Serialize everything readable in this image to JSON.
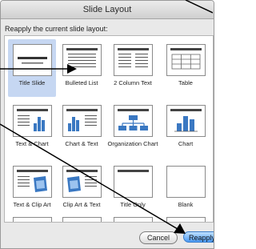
{
  "window": {
    "title": "Slide Layout"
  },
  "instruction": "Reapply the current slide layout:",
  "layouts": [
    {
      "label": "Title Slide",
      "selected": true,
      "icon": "layout-title-slide-icon"
    },
    {
      "label": "Bulleted List",
      "selected": false,
      "icon": "layout-bulleted-list-icon"
    },
    {
      "label": "2 Column Text",
      "selected": false,
      "icon": "layout-two-column-text-icon"
    },
    {
      "label": "Table",
      "selected": false,
      "icon": "layout-table-icon"
    },
    {
      "label": "Text & Chart",
      "selected": false,
      "icon": "layout-text-and-chart-icon"
    },
    {
      "label": "Chart & Text",
      "selected": false,
      "icon": "layout-chart-and-text-icon"
    },
    {
      "label": "Organization Chart",
      "selected": false,
      "icon": "layout-organization-chart-icon"
    },
    {
      "label": "Chart",
      "selected": false,
      "icon": "layout-chart-icon"
    },
    {
      "label": "Text & Clip Art",
      "selected": false,
      "icon": "layout-text-and-clip-art-icon"
    },
    {
      "label": "Clip Art & Text",
      "selected": false,
      "icon": "layout-clip-art-and-text-icon"
    },
    {
      "label": "Title Only",
      "selected": false,
      "icon": "layout-title-only-icon"
    },
    {
      "label": "Blank",
      "selected": false,
      "icon": "layout-blank-icon"
    }
  ],
  "buttons": {
    "cancel": "Cancel",
    "reapply": "Reapply"
  },
  "colors": {
    "selection": "#c6d7f2",
    "accent_button": "#4a9af4",
    "chart_bars": "#3a78c2",
    "annotation": "#000000"
  }
}
